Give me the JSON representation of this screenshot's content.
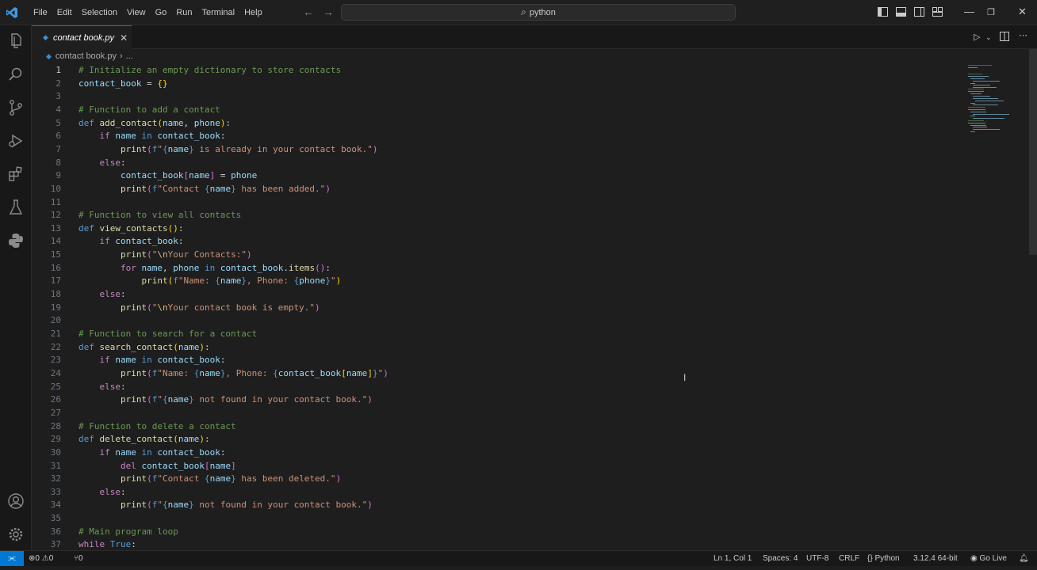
{
  "menu": [
    "File",
    "Edit",
    "Selection",
    "View",
    "Go",
    "Run",
    "Terminal",
    "Help"
  ],
  "search": {
    "text": "python",
    "icon": "search-icon"
  },
  "tab": {
    "label": "contact book.py",
    "close_glyph": "✕"
  },
  "breadcrumb": {
    "file": "contact book.py",
    "separator": "›",
    "ellipsis": "..."
  },
  "colors": {
    "accent": "#0078d4",
    "background": "#1e1e1e",
    "comment": "#6a9955",
    "keyword": "#c586c0",
    "string": "#ce9178"
  },
  "code": [
    {
      "n": "1",
      "parts": [
        [
          "c",
          "# Initialize an empty dictionary to store contacts"
        ]
      ]
    },
    {
      "n": "2",
      "parts": [
        [
          "v",
          "contact_book"
        ],
        [
          "n",
          " = "
        ],
        [
          "b",
          "{}"
        ]
      ]
    },
    {
      "n": "3",
      "parts": []
    },
    {
      "n": "4",
      "parts": [
        [
          "c",
          "# Function to add a contact"
        ]
      ]
    },
    {
      "n": "5",
      "parts": [
        [
          "d",
          "def "
        ],
        [
          "f",
          "add_contact"
        ],
        [
          "b",
          "("
        ],
        [
          "v",
          "name"
        ],
        [
          "n",
          ", "
        ],
        [
          "v",
          "phone"
        ],
        [
          "b",
          ")"
        ],
        [
          "n",
          ":"
        ]
      ]
    },
    {
      "n": "6",
      "parts": [
        [
          "n",
          "    "
        ],
        [
          "k",
          "if "
        ],
        [
          "v",
          "name"
        ],
        [
          "d",
          " in "
        ],
        [
          "v",
          "contact_book"
        ],
        [
          "n",
          ":"
        ]
      ]
    },
    {
      "n": "7",
      "parts": [
        [
          "n",
          "        "
        ],
        [
          "f",
          "print"
        ],
        [
          "p",
          "("
        ],
        [
          "d",
          "f"
        ],
        [
          "s",
          "\""
        ],
        [
          "d",
          "{"
        ],
        [
          "v",
          "name"
        ],
        [
          "d",
          "}"
        ],
        [
          "s",
          " is already in your contact book.\""
        ],
        [
          "p",
          ")"
        ]
      ]
    },
    {
      "n": "8",
      "parts": [
        [
          "n",
          "    "
        ],
        [
          "k",
          "else"
        ],
        [
          "n",
          ":"
        ]
      ]
    },
    {
      "n": "9",
      "parts": [
        [
          "n",
          "        "
        ],
        [
          "v",
          "contact_book"
        ],
        [
          "p",
          "["
        ],
        [
          "v",
          "name"
        ],
        [
          "p",
          "]"
        ],
        [
          "n",
          " = "
        ],
        [
          "v",
          "phone"
        ]
      ]
    },
    {
      "n": "10",
      "parts": [
        [
          "n",
          "        "
        ],
        [
          "f",
          "print"
        ],
        [
          "p",
          "("
        ],
        [
          "d",
          "f"
        ],
        [
          "s",
          "\"Contact "
        ],
        [
          "d",
          "{"
        ],
        [
          "v",
          "name"
        ],
        [
          "d",
          "}"
        ],
        [
          "s",
          " has been added.\""
        ],
        [
          "p",
          ")"
        ]
      ]
    },
    {
      "n": "11",
      "parts": []
    },
    {
      "n": "12",
      "parts": [
        [
          "c",
          "# Function to view all contacts"
        ]
      ]
    },
    {
      "n": "13",
      "parts": [
        [
          "d",
          "def "
        ],
        [
          "f",
          "view_contacts"
        ],
        [
          "b",
          "()"
        ],
        [
          "n",
          ":"
        ]
      ]
    },
    {
      "n": "14",
      "parts": [
        [
          "n",
          "    "
        ],
        [
          "k",
          "if "
        ],
        [
          "v",
          "contact_book"
        ],
        [
          "n",
          ":"
        ]
      ]
    },
    {
      "n": "15",
      "parts": [
        [
          "n",
          "        "
        ],
        [
          "f",
          "print"
        ],
        [
          "p",
          "("
        ],
        [
          "s",
          "\""
        ],
        [
          "e",
          "\\n"
        ],
        [
          "s",
          "Your Contacts:\""
        ],
        [
          "p",
          ")"
        ]
      ]
    },
    {
      "n": "16",
      "parts": [
        [
          "n",
          "        "
        ],
        [
          "k",
          "for "
        ],
        [
          "v",
          "name"
        ],
        [
          "n",
          ", "
        ],
        [
          "v",
          "phone"
        ],
        [
          "d",
          " in "
        ],
        [
          "v",
          "contact_book"
        ],
        [
          "n",
          "."
        ],
        [
          "f",
          "items"
        ],
        [
          "p",
          "()"
        ],
        [
          "n",
          ":"
        ]
      ]
    },
    {
      "n": "17",
      "parts": [
        [
          "n",
          "            "
        ],
        [
          "f",
          "print"
        ],
        [
          "b",
          "("
        ],
        [
          "d",
          "f"
        ],
        [
          "s",
          "\"Name: "
        ],
        [
          "d",
          "{"
        ],
        [
          "v",
          "name"
        ],
        [
          "d",
          "}"
        ],
        [
          "s",
          ", Phone: "
        ],
        [
          "d",
          "{"
        ],
        [
          "v",
          "phone"
        ],
        [
          "d",
          "}"
        ],
        [
          "s",
          "\""
        ],
        [
          "b",
          ")"
        ]
      ]
    },
    {
      "n": "18",
      "parts": [
        [
          "n",
          "    "
        ],
        [
          "k",
          "else"
        ],
        [
          "n",
          ":"
        ]
      ]
    },
    {
      "n": "19",
      "parts": [
        [
          "n",
          "        "
        ],
        [
          "f",
          "print"
        ],
        [
          "p",
          "("
        ],
        [
          "s",
          "\""
        ],
        [
          "e",
          "\\n"
        ],
        [
          "s",
          "Your contact book is empty.\""
        ],
        [
          "p",
          ")"
        ]
      ]
    },
    {
      "n": "20",
      "parts": []
    },
    {
      "n": "21",
      "parts": [
        [
          "c",
          "# Function to search for a contact"
        ]
      ]
    },
    {
      "n": "22",
      "parts": [
        [
          "d",
          "def "
        ],
        [
          "f",
          "search_contact"
        ],
        [
          "b",
          "("
        ],
        [
          "v",
          "name"
        ],
        [
          "b",
          ")"
        ],
        [
          "n",
          ":"
        ]
      ]
    },
    {
      "n": "23",
      "parts": [
        [
          "n",
          "    "
        ],
        [
          "k",
          "if "
        ],
        [
          "v",
          "name"
        ],
        [
          "d",
          " in "
        ],
        [
          "v",
          "contact_book"
        ],
        [
          "n",
          ":"
        ]
      ]
    },
    {
      "n": "24",
      "parts": [
        [
          "n",
          "        "
        ],
        [
          "f",
          "print"
        ],
        [
          "p",
          "("
        ],
        [
          "d",
          "f"
        ],
        [
          "s",
          "\"Name: "
        ],
        [
          "d",
          "{"
        ],
        [
          "v",
          "name"
        ],
        [
          "d",
          "}"
        ],
        [
          "s",
          ", Phone: "
        ],
        [
          "d",
          "{"
        ],
        [
          "v",
          "contact_book"
        ],
        [
          "b",
          "["
        ],
        [
          "v",
          "name"
        ],
        [
          "b",
          "]"
        ],
        [
          "d",
          "}"
        ],
        [
          "s",
          "\""
        ],
        [
          "p",
          ")"
        ]
      ]
    },
    {
      "n": "25",
      "parts": [
        [
          "n",
          "    "
        ],
        [
          "k",
          "else"
        ],
        [
          "n",
          ":"
        ]
      ]
    },
    {
      "n": "26",
      "parts": [
        [
          "n",
          "        "
        ],
        [
          "f",
          "print"
        ],
        [
          "p",
          "("
        ],
        [
          "d",
          "f"
        ],
        [
          "s",
          "\""
        ],
        [
          "d",
          "{"
        ],
        [
          "v",
          "name"
        ],
        [
          "d",
          "}"
        ],
        [
          "s",
          " not found in your contact book.\""
        ],
        [
          "p",
          ")"
        ]
      ]
    },
    {
      "n": "27",
      "parts": []
    },
    {
      "n": "28",
      "parts": [
        [
          "c",
          "# Function to delete a contact"
        ]
      ]
    },
    {
      "n": "29",
      "parts": [
        [
          "d",
          "def "
        ],
        [
          "f",
          "delete_contact"
        ],
        [
          "b",
          "("
        ],
        [
          "v",
          "name"
        ],
        [
          "b",
          ")"
        ],
        [
          "n",
          ":"
        ]
      ]
    },
    {
      "n": "30",
      "parts": [
        [
          "n",
          "    "
        ],
        [
          "k",
          "if "
        ],
        [
          "v",
          "name"
        ],
        [
          "d",
          " in "
        ],
        [
          "v",
          "contact_book"
        ],
        [
          "n",
          ":"
        ]
      ]
    },
    {
      "n": "31",
      "parts": [
        [
          "n",
          "        "
        ],
        [
          "k",
          "del "
        ],
        [
          "v",
          "contact_book"
        ],
        [
          "p",
          "["
        ],
        [
          "v",
          "name"
        ],
        [
          "p",
          "]"
        ]
      ]
    },
    {
      "n": "32",
      "parts": [
        [
          "n",
          "        "
        ],
        [
          "f",
          "print"
        ],
        [
          "p",
          "("
        ],
        [
          "d",
          "f"
        ],
        [
          "s",
          "\"Contact "
        ],
        [
          "d",
          "{"
        ],
        [
          "v",
          "name"
        ],
        [
          "d",
          "}"
        ],
        [
          "s",
          " has been deleted.\""
        ],
        [
          "p",
          ")"
        ]
      ]
    },
    {
      "n": "33",
      "parts": [
        [
          "n",
          "    "
        ],
        [
          "k",
          "else"
        ],
        [
          "n",
          ":"
        ]
      ]
    },
    {
      "n": "34",
      "parts": [
        [
          "n",
          "        "
        ],
        [
          "f",
          "print"
        ],
        [
          "p",
          "("
        ],
        [
          "d",
          "f"
        ],
        [
          "s",
          "\""
        ],
        [
          "d",
          "{"
        ],
        [
          "v",
          "name"
        ],
        [
          "d",
          "}"
        ],
        [
          "s",
          " not found in your contact book.\""
        ],
        [
          "p",
          ")"
        ]
      ]
    },
    {
      "n": "35",
      "parts": []
    },
    {
      "n": "36",
      "parts": [
        [
          "c",
          "# Main program loop"
        ]
      ]
    },
    {
      "n": "37",
      "parts": [
        [
          "k",
          "while "
        ],
        [
          "d",
          "True"
        ],
        [
          "n",
          ":"
        ]
      ]
    }
  ],
  "status": {
    "errors": "0",
    "warnings": "0",
    "ports": "0",
    "position": "Ln 1, Col 1",
    "spaces": "Spaces: 4",
    "encoding": "UTF-8",
    "eol": "CRLF",
    "language": "Python",
    "interpreter": "3.12.4 64-bit",
    "golive": "Go Live"
  }
}
